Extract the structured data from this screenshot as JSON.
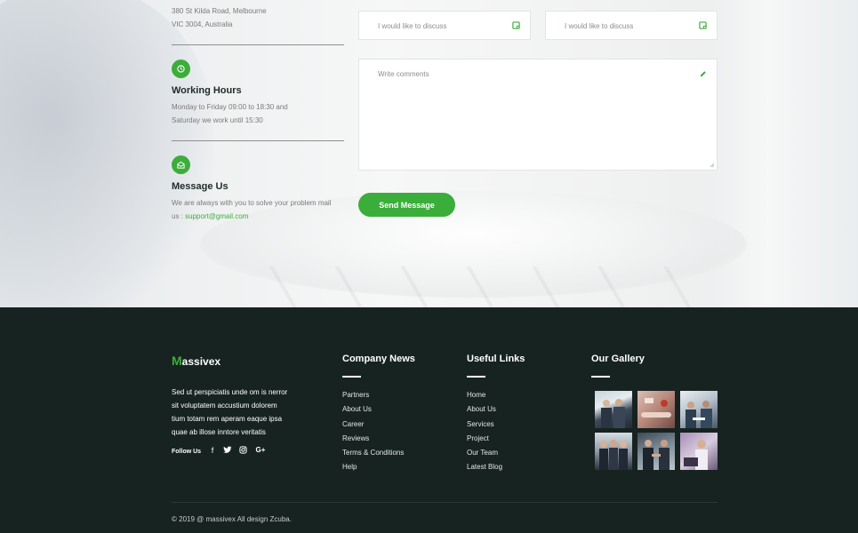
{
  "contact": {
    "address_lines": [
      "380 St Kilda Road, Melbourne",
      "VIC 3004, Australia"
    ],
    "hours": {
      "title": "Working Hours",
      "lines": [
        "Monday to Friday 09:00 to 18:30 and",
        "Saturday we work until 15:30"
      ],
      "icon": "clock-icon"
    },
    "message": {
      "title": "Message Us",
      "line1": "We are always with you to solve your problem mail",
      "line2_prefix": "us : ",
      "email": "support@gmail.com",
      "icon": "mail-icon"
    },
    "form": {
      "subject1_placeholder": "I would like to discuss",
      "subject2_placeholder": "I would like to discuss",
      "comments_placeholder": "Write comments",
      "send_label": "Send Message"
    }
  },
  "footer": {
    "logo": {
      "first_letter": "M",
      "rest": "assivex"
    },
    "about": [
      "Sed ut perspiciatis unde om is nerror",
      "sit voluptatem accustium dolorem",
      "tium totam rem aperam eaque ipsa",
      "quae ab illose inntore veritatis"
    ],
    "follow_label": "Follow Us",
    "social": [
      {
        "icon": "facebook-icon",
        "glyph": "f"
      },
      {
        "icon": "twitter-icon",
        "glyph": "🐦"
      },
      {
        "icon": "instagram-icon",
        "glyph": "◎"
      },
      {
        "icon": "google-plus-icon",
        "glyph": "G+"
      }
    ],
    "company_news": {
      "title": "Company News",
      "items": [
        "Partners",
        "About Us",
        "Career",
        "Reviews",
        "Terms & Conditions",
        "Help"
      ]
    },
    "useful_links": {
      "title": "Useful Links",
      "items": [
        "Home",
        "About Us",
        "Services",
        "Project",
        "Our Team",
        "Latest Blog"
      ]
    },
    "gallery": {
      "title": "Our Gallery",
      "photos": [
        "team-photo",
        "handshake-photo",
        "meeting-photo",
        "business-group-photo",
        "business-handshake-photo",
        "office-work-photo"
      ]
    },
    "copyright": "© 2019 @ massivex All design Zcuba."
  },
  "colors": {
    "accent": "#3bad3b",
    "footer_bg": "#172321"
  }
}
